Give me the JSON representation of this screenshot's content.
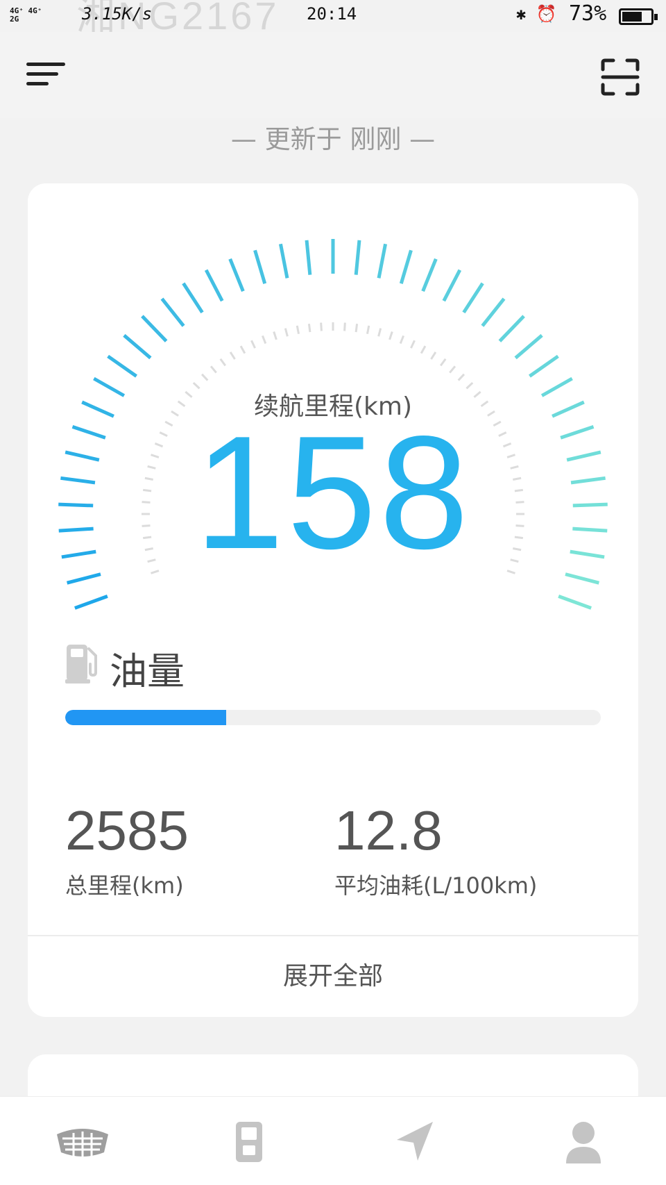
{
  "status_bar": {
    "network": "4G⁺ 4G⁺",
    "network2": "2G",
    "speed": "3.15K/s",
    "time": "20:14",
    "battery": "73%",
    "battery_level": 0.73,
    "icons": [
      "bluetooth-icon",
      "alarm-icon"
    ]
  },
  "background_text": "湘NG2167",
  "header": {
    "menu_icon": "menu-icon",
    "scan_icon": "scan-icon"
  },
  "updated_text": "— 更新于 刚刚 —",
  "range": {
    "label": "续航里程(km)",
    "value": "158"
  },
  "fuel": {
    "title": "油量",
    "level": 0.3,
    "icon": "fuel-pump-icon"
  },
  "stats": [
    {
      "value": "2585",
      "label": "总里程(km)"
    },
    {
      "value": "12.8",
      "label": "平均油耗(L/100km)"
    }
  ],
  "expand_label": "展开全部",
  "tabs": [
    {
      "icon": "geely-logo-icon"
    },
    {
      "icon": "car-key-icon"
    },
    {
      "icon": "navigation-icon"
    },
    {
      "icon": "profile-icon"
    }
  ],
  "colors": {
    "accent_blue": "#27b3ee",
    "fuel_bar": "#2196f3",
    "gauge_start": "#1ea7ea",
    "gauge_end": "#7ee6d6"
  }
}
